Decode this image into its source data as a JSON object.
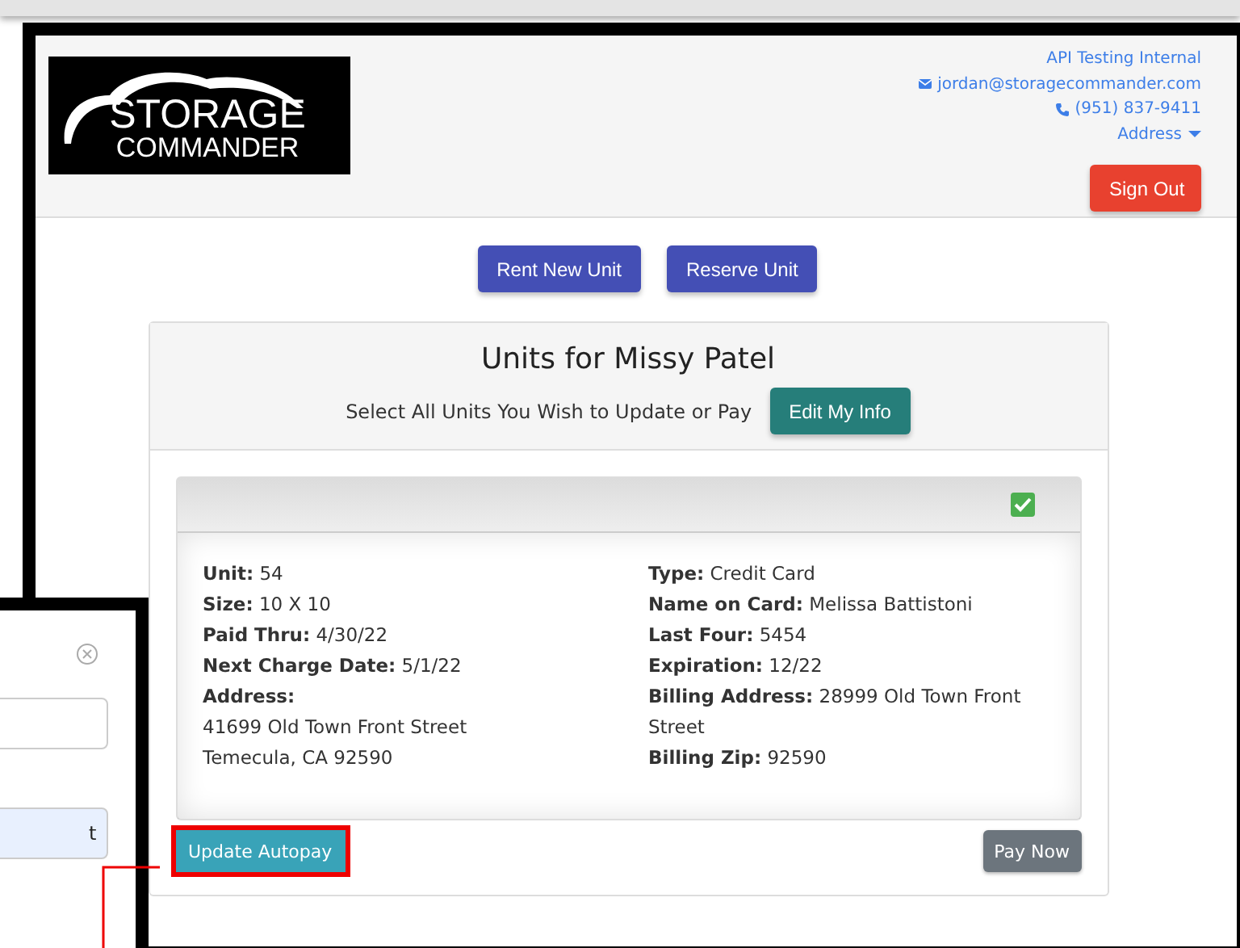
{
  "header": {
    "logo": {
      "line_1": "STORAGE",
      "line_2": "COMMANDER"
    },
    "account": {
      "name": "API Testing Internal",
      "email": "jordan@storagecommander.com",
      "phone": "(951) 837-9411",
      "address_menu": "Address"
    },
    "sign_out": "Sign Out"
  },
  "actions": [
    "Rent New Unit",
    "Reserve Unit"
  ],
  "panel": {
    "title": "Units for Missy Patel",
    "subtitle": "Select All Units You Wish to Update or Pay",
    "edit_button": "Edit My Info"
  },
  "unit": {
    "checked": true,
    "left_column": [
      {
        "kind": "field",
        "text": "**Unit:** 54"
      },
      {
        "kind": "field",
        "text": "**Size:** 10 X 10"
      },
      {
        "kind": "field",
        "text": "**Paid Thru:** 4/30/22"
      },
      {
        "kind": "field",
        "text": "**Next Charge Date:** 5/1/22"
      },
      {
        "kind": "heading",
        "text": "Address:"
      },
      {
        "kind": "line",
        "text": "41699 Old Town Front Street"
      },
      {
        "kind": "line",
        "text": "Temecula, CA 92590"
      }
    ],
    "right_column": [
      {
        "kind": "field",
        "text": "**Type:** Credit Card"
      },
      {
        "kind": "field",
        "text": "**Name on Card:** Melissa Battistoni"
      },
      {
        "kind": "field",
        "text": "**Last Four:** 5454"
      },
      {
        "kind": "field",
        "text": "**Expiration:** 12/22"
      },
      {
        "kind": "field",
        "text": "**Billing Address:** 28999 Old Town Front Street"
      },
      {
        "kind": "field",
        "text": "**Billing Zip:** 92590"
      }
    ],
    "buttons": [
      {
        "label": "Update Autopay",
        "kind": "info",
        "highlighted": true
      },
      {
        "label": "Pay Now",
        "kind": "secondary",
        "highlighted": false
      }
    ]
  },
  "popup": {
    "field_value": "t"
  }
}
